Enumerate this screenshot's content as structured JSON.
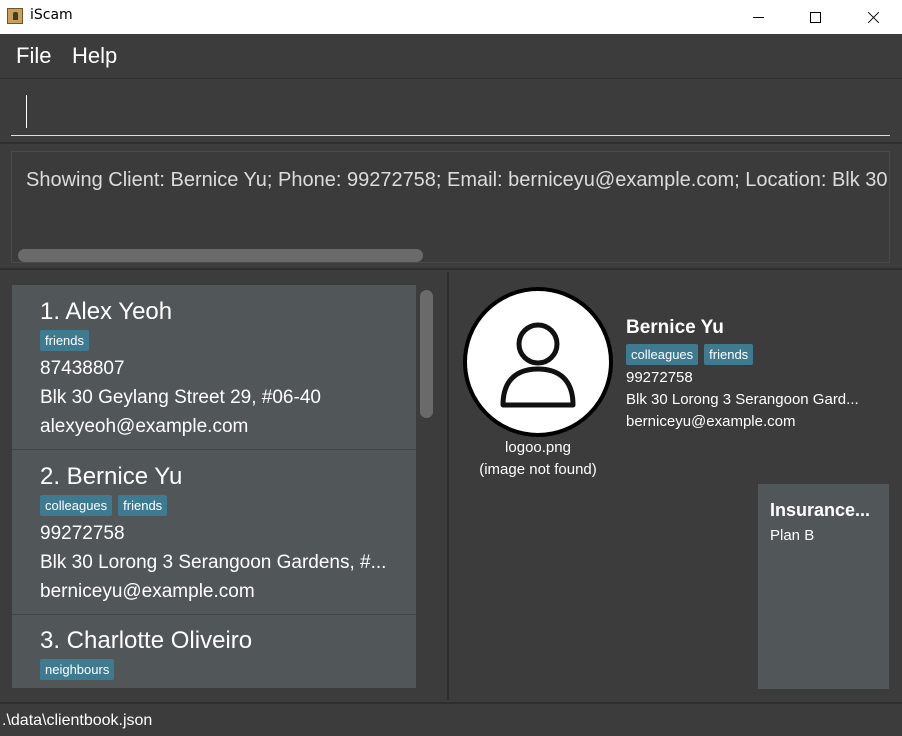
{
  "window": {
    "title": "iScam"
  },
  "menu": {
    "file_label": "File",
    "help_label": "Help"
  },
  "command": {
    "value": ""
  },
  "result": {
    "text": "Showing Client: Bernice Yu; Phone: 99272758; Email: berniceyu@example.com; Location: Blk 30"
  },
  "clients": [
    {
      "index_name": "1.  Alex Yeoh",
      "tags": [
        "friends"
      ],
      "phone": "87438807",
      "address": "Blk 30 Geylang Street 29, #06-40",
      "email": "alexyeoh@example.com"
    },
    {
      "index_name": "2.  Bernice Yu",
      "tags": [
        "colleagues",
        "friends"
      ],
      "phone": "99272758",
      "address": "Blk 30 Lorong 3 Serangoon Gardens, #...",
      "email": "berniceyu@example.com"
    },
    {
      "index_name": "3.  Charlotte Oliveiro",
      "tags": [
        "neighbours"
      ]
    }
  ],
  "detail": {
    "image_caption_1": "logoo.png",
    "image_caption_2": "(image not found)",
    "name": "Bernice Yu",
    "tags": [
      "colleagues",
      "friends"
    ],
    "phone": "99272758",
    "address": "Blk 30 Lorong 3 Serangoon Gard...",
    "email": "berniceyu@example.com",
    "insurance_title": "Insurance...",
    "insurance_plan": "Plan B"
  },
  "status": {
    "file_path": ".\\data\\clientbook.json"
  },
  "colors": {
    "tag_bg": "#3e7b91",
    "card_bg": "#515658",
    "panel_bg": "#3c3c3c"
  }
}
